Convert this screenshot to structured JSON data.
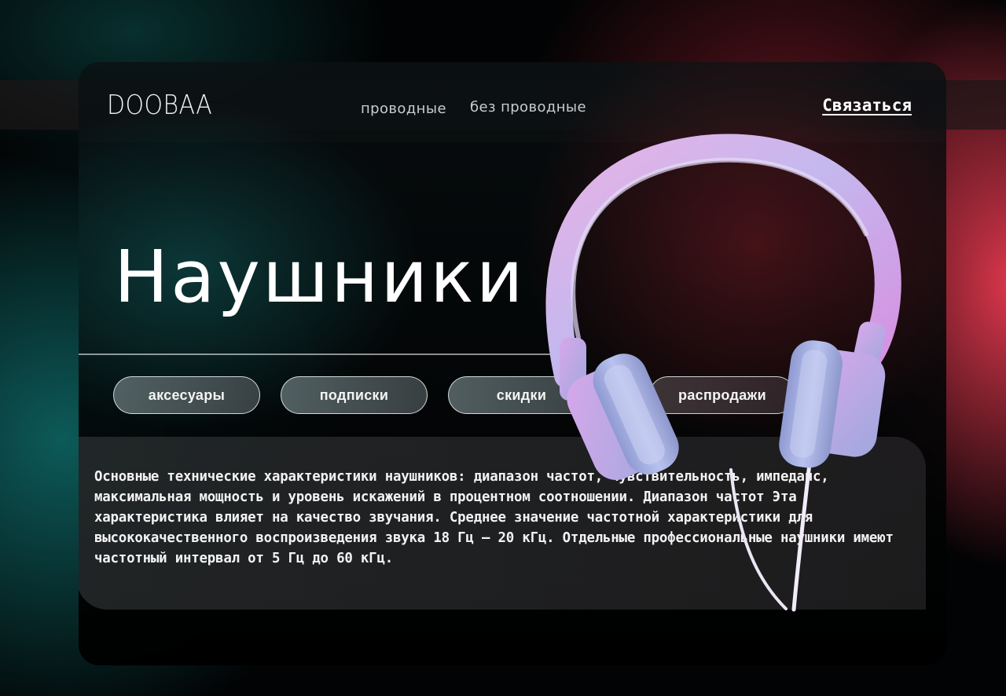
{
  "header": {
    "logo": "DOOBAA",
    "nav": [
      {
        "label": "проводные"
      },
      {
        "label": "без проводные"
      }
    ],
    "contact_label": "Связаться"
  },
  "hero": {
    "title": "Наушники",
    "chips": [
      {
        "label": "аксесуары"
      },
      {
        "label": "подписки"
      },
      {
        "label": "скидки"
      },
      {
        "label": "распродажи"
      }
    ],
    "description": "Основные технические характеристики наушников: диапазон частот, чувствительность, импеданс, максимальная мощность и уровень искажений в процентном соотношении. Диапазон частот Эта характеристика влияет на качество звучания. Среднее значение частотной характеристики для высококачественного воспроизведения звука 18 Гц — 20 кГц. Отдельные профессиональные наушники имеют частотный интервал от 5 Гц до 60 кГц.",
    "image": {
      "icon": "headphones-photo"
    }
  },
  "colors": {
    "accent_red": "#e93a50",
    "accent_teal": "#107876",
    "headphones": "#b7b3ec",
    "cable": "#ece6f4"
  }
}
